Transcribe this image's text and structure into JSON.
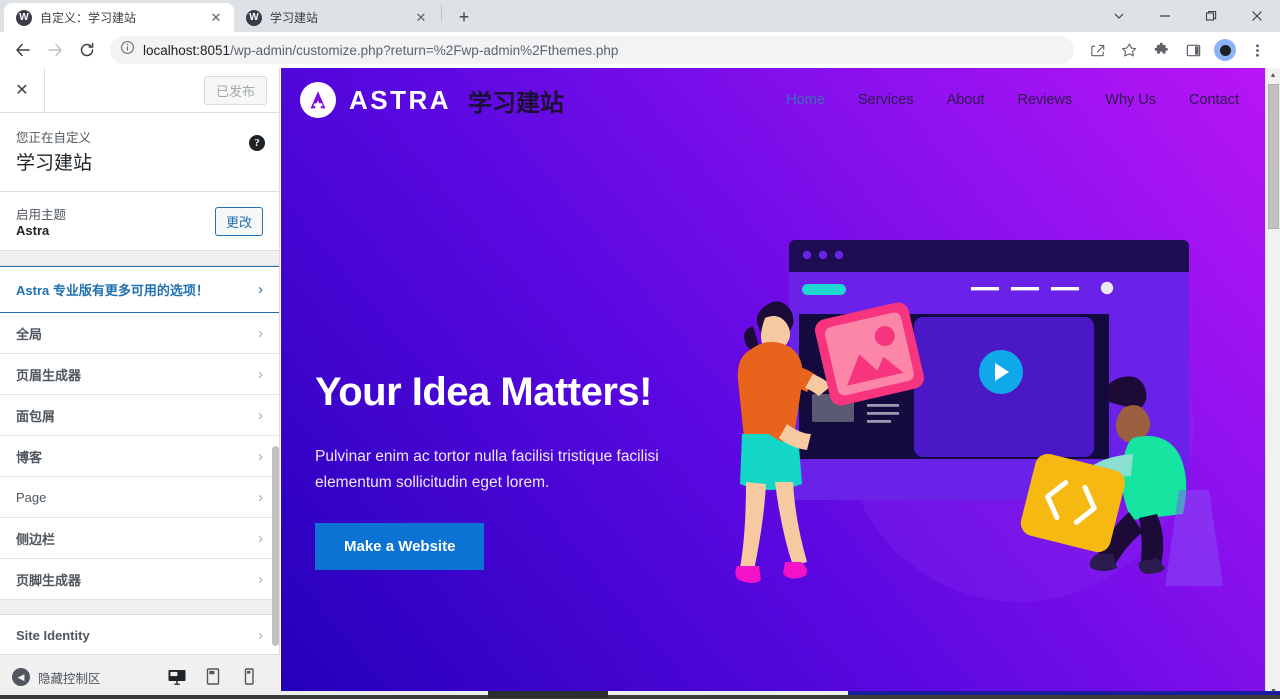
{
  "browser": {
    "tabs": [
      {
        "title": "自定义：学习建站",
        "favicon": "wordpress-icon",
        "active": true,
        "close_glyph": "✕"
      },
      {
        "title": "学习建站",
        "favicon": "wordpress-icon",
        "active": false,
        "close_glyph": "✕"
      }
    ],
    "newtab_glyph": "+",
    "window_controls": {
      "tabsearch": "⌄",
      "minimize": "—",
      "maximize": "❐",
      "close": "✕"
    },
    "nav": {
      "back": "←",
      "forward": "→",
      "reload": "⟳"
    },
    "omnibox": {
      "info_icon": "info-icon",
      "url_host": "localhost:8051",
      "url_path": "/wp-admin/customize.php?return=%2Fwp-admin%2Fthemes.php",
      "share_icon": "share-icon",
      "bookmark_icon": "star-icon"
    },
    "actions": {
      "extensions": "puzzle-icon",
      "side_panel": "side-panel-icon",
      "profile": "profile-avatar",
      "menu": "three-dot-menu-icon"
    }
  },
  "customizer": {
    "close_glyph": "✕",
    "publish_label": "已发布",
    "help_glyph": "?",
    "info_label": "您正在自定义",
    "info_title": "学习建站",
    "theme_label": "启用主题",
    "theme_name": "Astra",
    "change_label": "更改",
    "pro_notice": "Astra 专业版有更多可用的选项！",
    "arrow_glyph": "›",
    "items": [
      {
        "label": "全局",
        "bold": true
      },
      {
        "label": "页眉生成器",
        "bold": true
      },
      {
        "label": "面包屑",
        "bold": true
      },
      {
        "label": "博客",
        "bold": true
      },
      {
        "label": "Page",
        "bold": false
      },
      {
        "label": "侧边栏",
        "bold": true
      },
      {
        "label": "页脚生成器",
        "bold": true
      }
    ],
    "items_after_gap": [
      {
        "label": "Site Identity",
        "bold": true
      }
    ],
    "footer": {
      "collapse_label": "隐藏控制区",
      "collapse_glyph": "◀",
      "devices": [
        {
          "name": "desktop",
          "active": true
        },
        {
          "name": "tablet",
          "active": false
        },
        {
          "name": "mobile",
          "active": false
        }
      ]
    }
  },
  "preview": {
    "brand": {
      "logo": "astra-logo-icon",
      "name": "ASTRA",
      "site_title": "学习建站"
    },
    "nav_links": [
      {
        "label": "Home",
        "active": true
      },
      {
        "label": "Services",
        "active": false
      },
      {
        "label": "About",
        "active": false
      },
      {
        "label": "Reviews",
        "active": false
      },
      {
        "label": "Why Us",
        "active": false
      },
      {
        "label": "Contact",
        "active": false
      }
    ],
    "hero": {
      "title": "Your Idea Matters!",
      "subtitle": "Pulvinar enim ac tortor nulla facilisi tristique facilisi elementum sollicitudin eget lorem.",
      "cta_label": "Make a Website",
      "illustration": "team-building-website-illustration"
    },
    "colors": {
      "gradient_start": "#2300b9",
      "gradient_end": "#b915f5",
      "cta_bg": "#0c73d4",
      "nav_active": "#3a6fb5"
    }
  }
}
